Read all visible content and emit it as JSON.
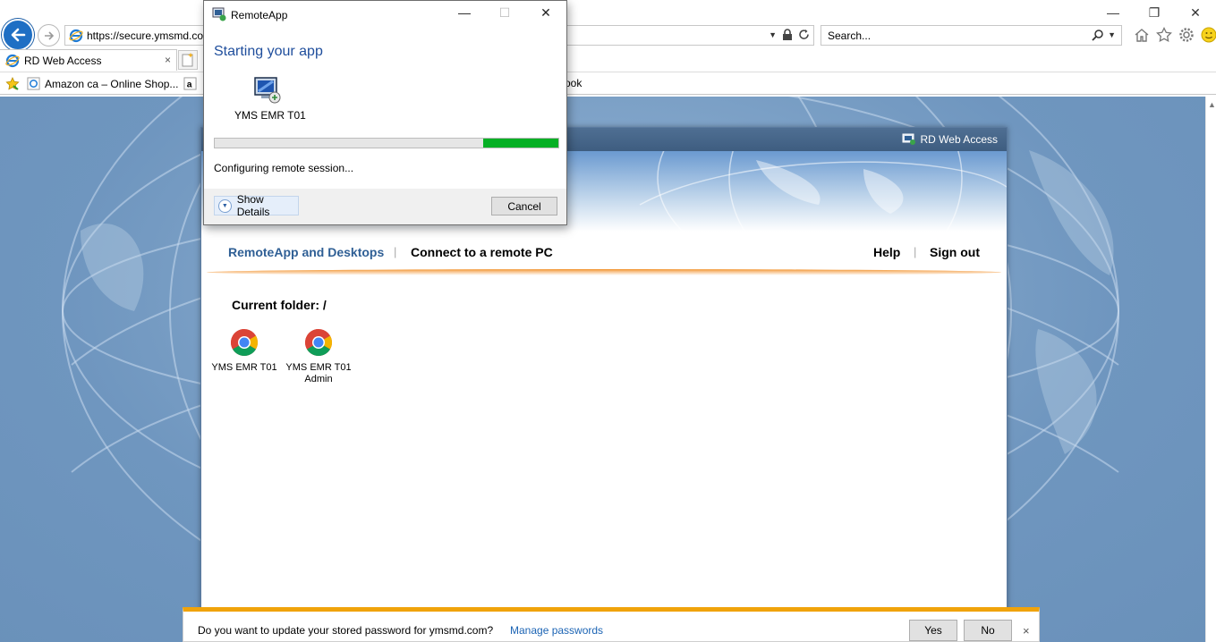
{
  "browser": {
    "address_url": "https://secure.ymsmd.co",
    "search_placeholder": "Search...",
    "tab_label": "RD Web Access",
    "tab_close": "×",
    "favorites": [
      {
        "label": "Amazon ca – Online Shop..."
      },
      {
        "label": "ook"
      }
    ],
    "window_controls": {
      "minimize": "—",
      "restore": "❐",
      "close": "✕"
    }
  },
  "rdweb": {
    "brand_label": "RD Web Access",
    "nav": {
      "remoteapp": "RemoteApp and Desktops",
      "connect": "Connect to a remote PC",
      "help": "Help",
      "signout": "Sign out",
      "separator": "|"
    },
    "current_folder": "Current folder: /",
    "apps": [
      {
        "label": "YMS EMR T01",
        "icon": "chrome-icon"
      },
      {
        "label": "YMS EMR T01 Admin",
        "icon": "chrome-icon"
      }
    ]
  },
  "dialog": {
    "title": "RemoteApp",
    "heading": "Starting your app",
    "app_name": "YMS EMR T01",
    "status": "Configuring remote session...",
    "show_details": "Show Details",
    "cancel": "Cancel",
    "progress_fraction": 0.22,
    "progress_color": "#06b025",
    "controls": {
      "minimize": "—",
      "maximize": "☐",
      "close": "✕"
    }
  },
  "password_bar": {
    "message": "Do you want to update your stored password for ymsmd.com?",
    "manage_link": "Manage passwords",
    "yes": "Yes",
    "no": "No",
    "close": "×"
  },
  "colors": {
    "accent_blue": "#1f4e9c",
    "nav_active": "#2f5f95",
    "notification_border": "#f0a30a",
    "link": "#1c64b4"
  }
}
